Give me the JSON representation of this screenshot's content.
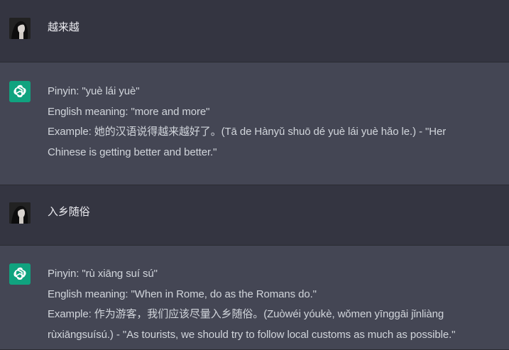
{
  "conversation": [
    {
      "role": "user",
      "text": "越来越"
    },
    {
      "role": "assistant",
      "lines": [
        "Pinyin: \"yuè lái yuè\"",
        "English meaning: \"more and more\"",
        "Example: 她的汉语说得越来越好了。(Tā de Hànyǔ shuō dé yuè lái yuè hǎo le.) - \"Her",
        "Chinese is getting better and better.\""
      ]
    },
    {
      "role": "user",
      "text": "入乡随俗"
    },
    {
      "role": "assistant",
      "lines": [
        "Pinyin: \"rù xiāng suí sú\"",
        "English meaning: \"When in Rome, do as the Romans do.\"",
        "Example: 作为游客，我们应该尽量入乡随俗。(Zuòwéi yóukè, wǒmen yīnggāi jǐnliàng",
        "rùxiāngsuísú.) - \"As tourists, we should try to follow local customs as much as possible.\""
      ]
    }
  ],
  "icons": {
    "user_avatar": "user-avatar-photo",
    "assistant_avatar": "chatgpt-logo-icon",
    "assistant_color": "#10a37f"
  }
}
